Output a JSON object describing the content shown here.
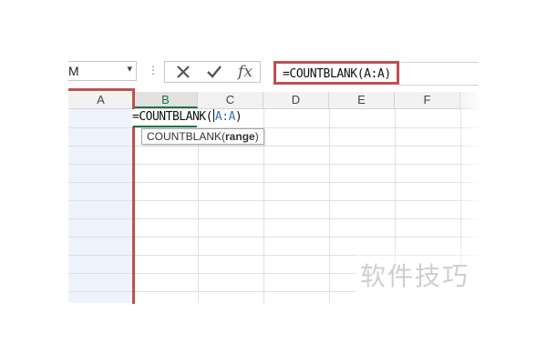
{
  "namebox": {
    "value": "M"
  },
  "formula_bar": {
    "cancel_icon": "x-icon",
    "enter_icon": "check-icon",
    "fx_label": "fx",
    "formula": "=COUNTBLANK(A:A)"
  },
  "columns": [
    "A",
    "B",
    "C",
    "D",
    "E",
    "F"
  ],
  "active_column": "B",
  "cell_editor": {
    "prefix": "=COUNTBLANK(",
    "ref": "A:A",
    "suffix": ")"
  },
  "tooltip": {
    "function": "COUNTBLANK(",
    "arg": "range",
    "close": ")"
  },
  "watermark": "软件技巧",
  "colors": {
    "highlight_red": "#c0504d",
    "active_green": "#217346",
    "selection_fill": "#eef3fd"
  }
}
